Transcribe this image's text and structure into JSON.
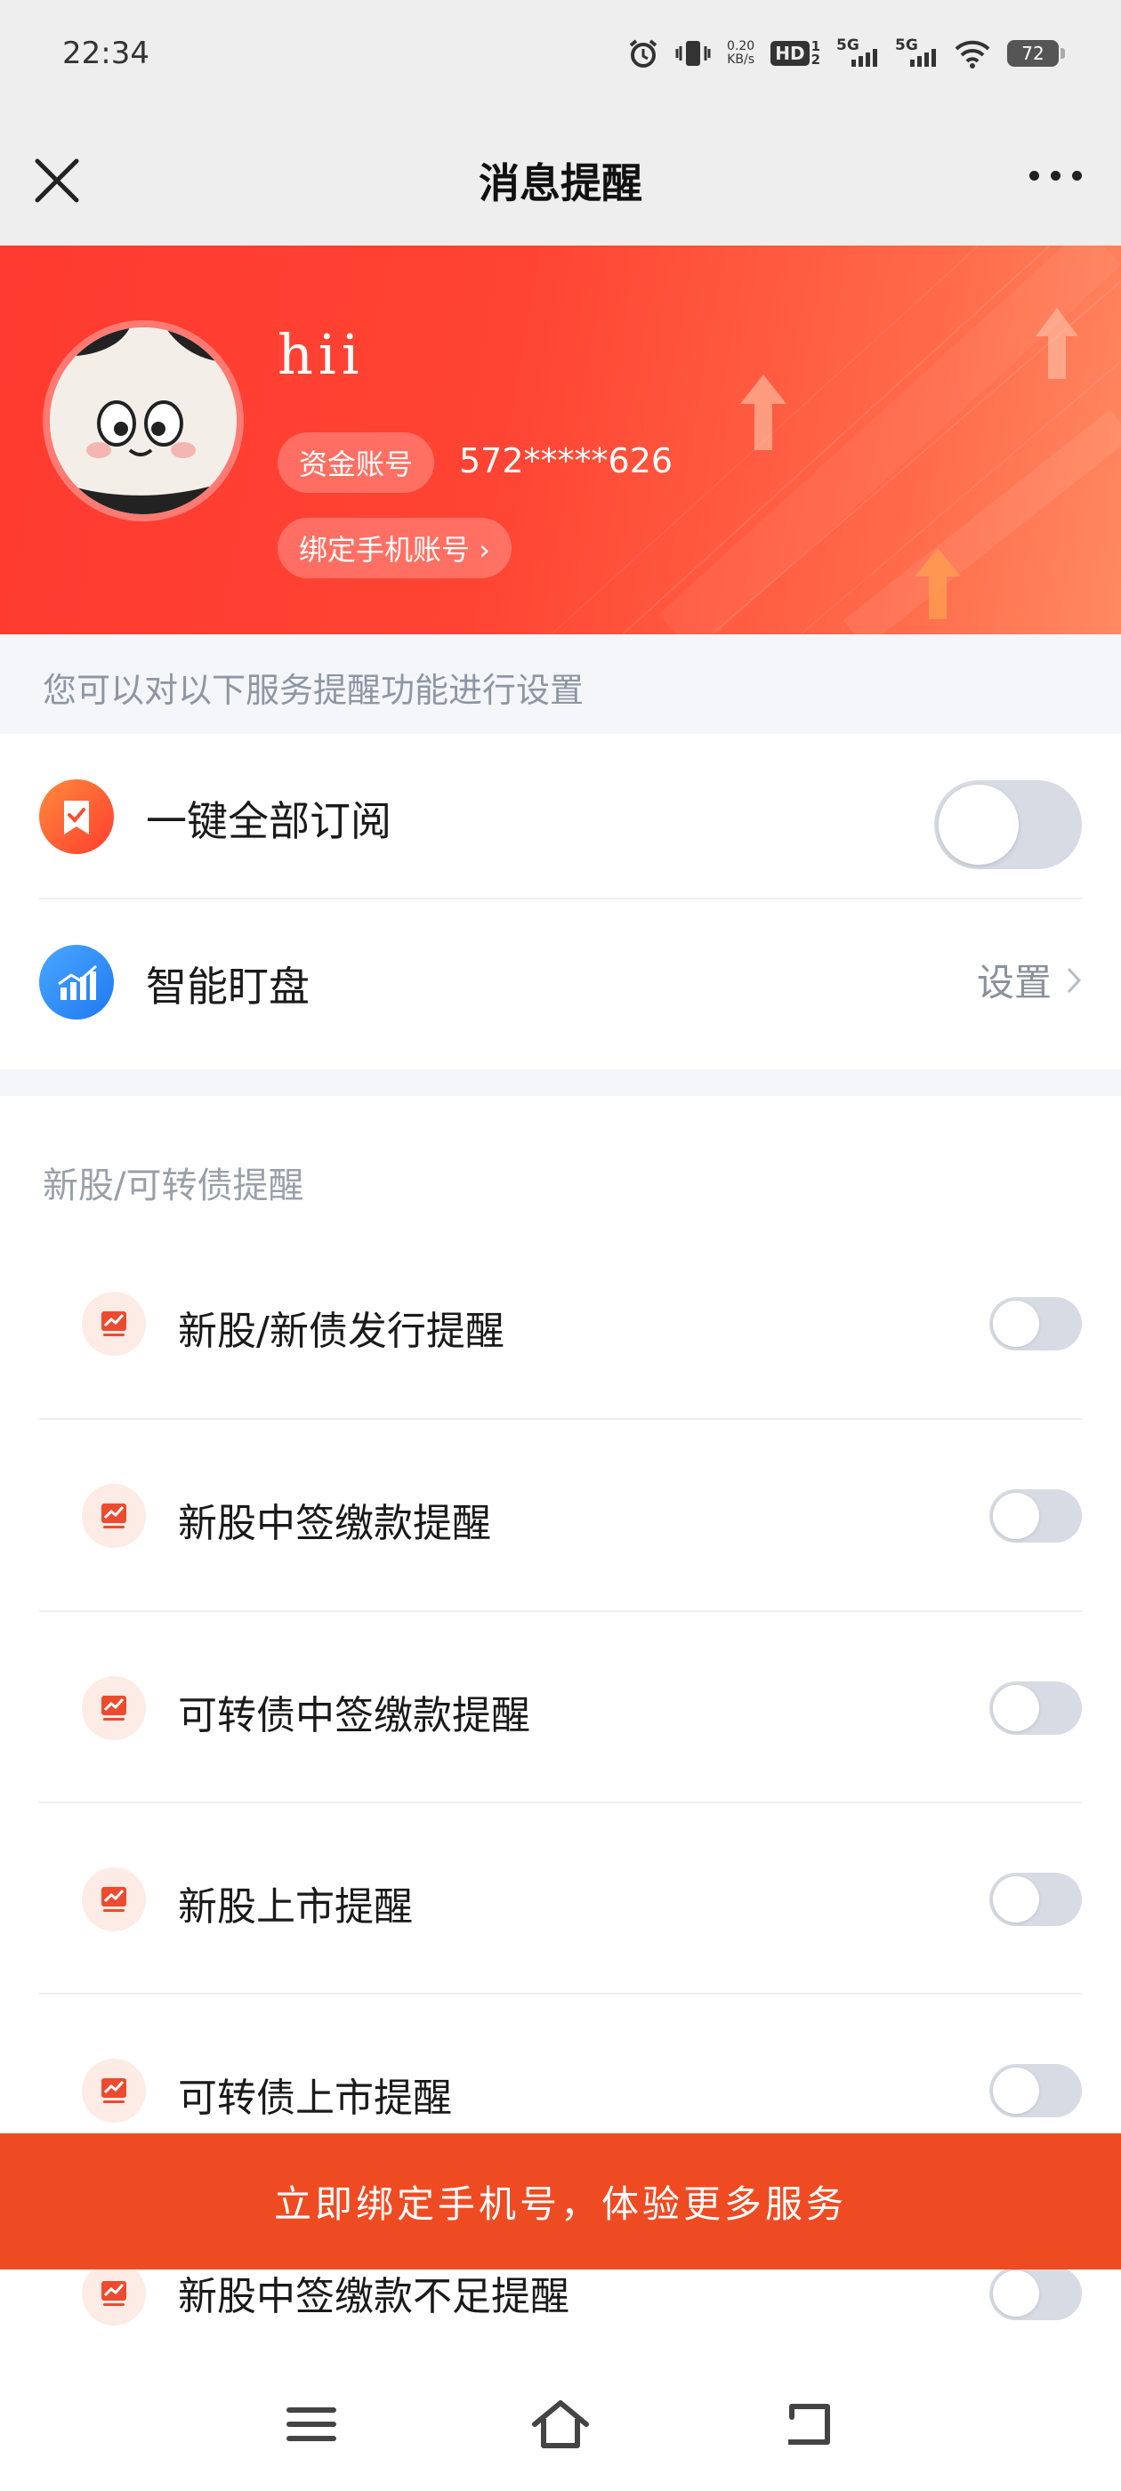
{
  "status_bar": {
    "time": "22:34",
    "net_speed_value": "0.20",
    "net_speed_unit": "KB/s",
    "hd_label": "HD",
    "hd_sup": "1",
    "hd_sub": "2",
    "sim1_label": "5G",
    "sim2_label": "5G",
    "battery": "72",
    "icons": [
      "alarm-icon",
      "vibrate-icon",
      "wifi-icon",
      "battery-icon"
    ]
  },
  "nav": {
    "title": "消息提醒",
    "close_icon": "close-icon",
    "more_icon": "more-icon"
  },
  "profile": {
    "name": "hii",
    "account_label": "资金账号",
    "account_value": "572*****626",
    "bind_phone_link": "绑定手机账号 ›"
  },
  "tip": "您可以对以下服务提醒功能进行设置",
  "main_rows": {
    "subscribe_all": {
      "label": "一键全部订阅",
      "enabled": false,
      "icon": "bookmark-check-icon"
    },
    "smart_watch": {
      "label": "智能盯盘",
      "action": "设置",
      "icon": "chart-bars-icon"
    }
  },
  "section": {
    "title": "新股/可转债提醒",
    "items": [
      {
        "label": "新股/新债发行提醒",
        "enabled": false,
        "icon": "trend-chart-icon"
      },
      {
        "label": "新股中签缴款提醒",
        "enabled": false,
        "icon": "trend-chart-icon"
      },
      {
        "label": "可转债中签缴款提醒",
        "enabled": false,
        "icon": "trend-chart-icon"
      },
      {
        "label": "新股上市提醒",
        "enabled": false,
        "icon": "trend-chart-icon"
      },
      {
        "label": "可转债上市提醒",
        "enabled": false,
        "icon": "trend-chart-icon"
      },
      {
        "label": "新股中签缴款不足提醒",
        "enabled": false,
        "icon": "trend-chart-icon"
      }
    ]
  },
  "cta": "立即绑定手机号，体验更多服务",
  "colors": {
    "brand_red": "#ff3a30",
    "cta_orange": "#ef4b23",
    "toggle_off": "#d7dbe3",
    "muted_text": "#8e96a3"
  }
}
